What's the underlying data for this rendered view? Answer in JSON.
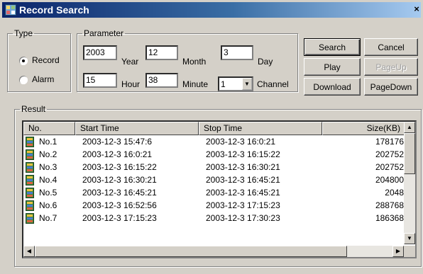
{
  "window": {
    "title": "Record Search",
    "close_glyph": "×"
  },
  "type_group": {
    "legend": "Type",
    "record_label": "Record",
    "alarm_label": "Alarm",
    "selected": "Record"
  },
  "parameter_group": {
    "legend": "Parameter",
    "year_value": "2003",
    "year_label": "Year",
    "month_value": "12",
    "month_label": "Month",
    "day_value": "3",
    "day_label": "Day",
    "hour_value": "15",
    "hour_label": "Hour",
    "minute_value": "38",
    "minute_label": "Minute",
    "channel_value": "1",
    "channel_label": "Channel"
  },
  "buttons": {
    "search": "Search",
    "cancel": "Cancel",
    "play": "Play",
    "pageup": "PageUp",
    "download": "Download",
    "pagedown": "PageDown"
  },
  "result": {
    "legend": "Result",
    "columns": [
      "No.",
      "Start Time",
      "Stop Time",
      "Size(KB)"
    ],
    "rows": [
      [
        "No.1",
        "2003-12-3 15:47:6",
        "2003-12-3 16:0:21",
        "178176"
      ],
      [
        "No.2",
        "2003-12-3 16:0:21",
        "2003-12-3 16:15:22",
        "202752"
      ],
      [
        "No.3",
        "2003-12-3 16:15:22",
        "2003-12-3 16:30:21",
        "202752"
      ],
      [
        "No.4",
        "2003-12-3 16:30:21",
        "2003-12-3 16:45:21",
        "204800"
      ],
      [
        "No.5",
        "2003-12-3 16:45:21",
        "2003-12-3 16:45:21",
        "2048"
      ],
      [
        "No.6",
        "2003-12-3 16:52:56",
        "2003-12-3 17:15:23",
        "288768"
      ],
      [
        "No.7",
        "2003-12-3 17:15:23",
        "2003-12-3 17:30:23",
        "186368"
      ]
    ]
  },
  "icons": {
    "app": "record-search-app-icon",
    "row": "video-record-icon"
  },
  "colors": {
    "title_start": "#0a246a",
    "title_end": "#a6caf0",
    "dialog_bg": "#d4d0c8",
    "disabled_text": "#a0a0a0"
  }
}
